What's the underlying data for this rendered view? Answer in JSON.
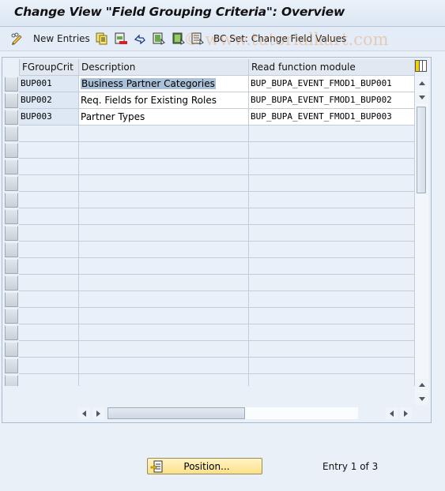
{
  "window": {
    "title": "Change View \"Field Grouping Criteria\": Overview"
  },
  "toolbar": {
    "items": [
      {
        "icon": "change-display-icon",
        "label": ""
      },
      {
        "icon": "new-entries-icon",
        "label": "New Entries"
      },
      {
        "icon": "copy-icon",
        "label": ""
      },
      {
        "icon": "delete-icon",
        "label": ""
      },
      {
        "icon": "undo-change-icon",
        "label": ""
      },
      {
        "icon": "select-all-icon",
        "label": ""
      },
      {
        "icon": "select-block-icon",
        "label": ""
      },
      {
        "icon": "deselect-all-icon",
        "label": ""
      },
      {
        "icon": "bc-set-icon",
        "label": "BC Set: Change Field Values"
      }
    ],
    "new_entries_label": "New Entries",
    "bc_set_label": "BC Set: Change Field Values"
  },
  "watermark": "© www.tutorialkart.com",
  "table": {
    "columns": [
      "FGroupCrit",
      "Description",
      "Read function module"
    ],
    "rows": [
      {
        "key": "BUP001",
        "description": "Business Partner Categories",
        "module": "BUP_BUPA_EVENT_FMOD1_BUP001",
        "selected_text": true
      },
      {
        "key": "BUP002",
        "description": "Req. Fields for Existing Roles",
        "module": "BUP_BUPA_EVENT_FMOD1_BUP002",
        "selected_text": false
      },
      {
        "key": "BUP003",
        "description": "Partner Types",
        "module": "BUP_BUPA_EVENT_FMOD1_BUP003",
        "selected_text": false
      }
    ],
    "empty_rows": 16,
    "column_settings_icon": "table-settings-icon"
  },
  "footer": {
    "position_button_label": "Position...",
    "entry_info": "Entry 1 of 3"
  },
  "colors": {
    "position_button": "#fbe189",
    "selection_highlight": "#aac1da",
    "background": "#e9f0f8"
  }
}
